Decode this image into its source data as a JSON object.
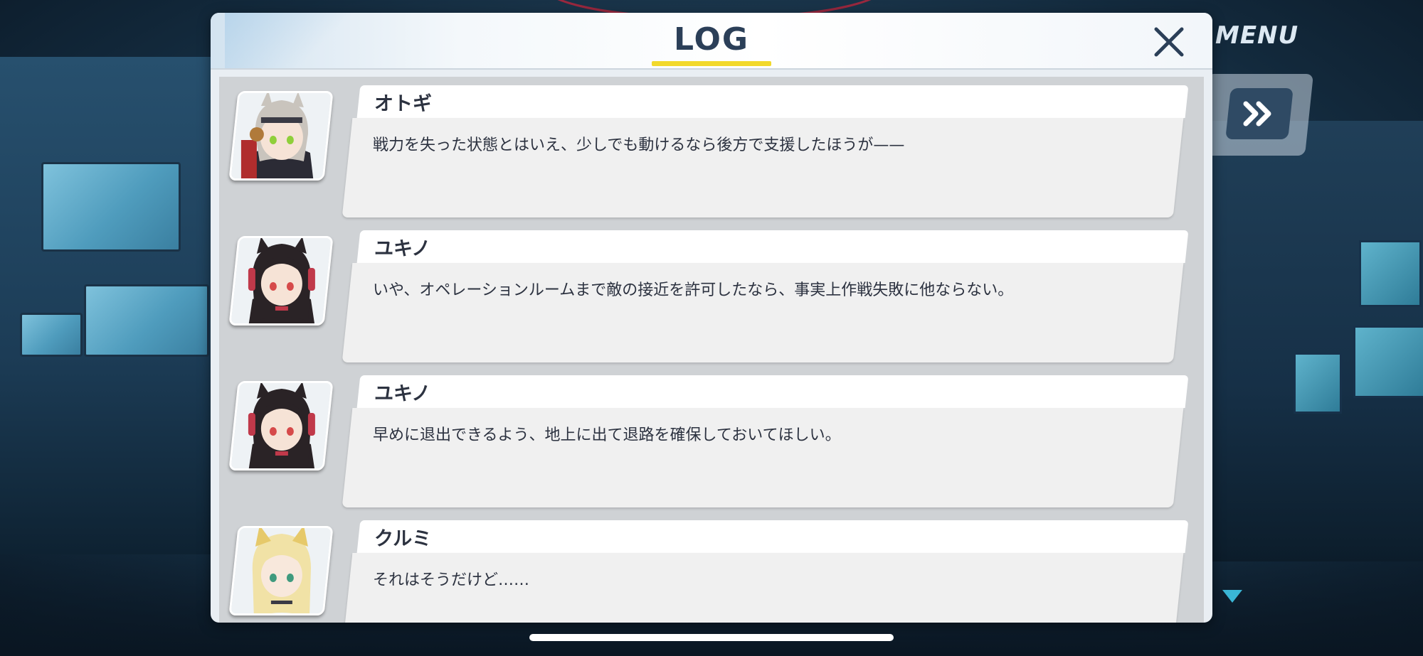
{
  "header": {
    "title": "LOG",
    "close_icon": "close-icon"
  },
  "hud": {
    "menu_label": "MENU",
    "fast_forward_icon": "fast-forward-icon",
    "scroll_indicator_icon": "triangle-down-icon"
  },
  "entries": [
    {
      "name": "オトギ",
      "text": "戦力を失った状態とはいえ、少しでも動けるなら後方で支援したほうが——",
      "portrait": {
        "hair": "#c9c4bd",
        "eye": "#8fcf3a",
        "accent": "#b07a3a"
      }
    },
    {
      "name": "ユキノ",
      "text": "いや、オペレーションルームまで敵の接近を許可したなら、事実上作戦失敗に他ならない。",
      "portrait": {
        "hair": "#2a2326",
        "eye": "#d64a4a",
        "accent": "#c0394a"
      }
    },
    {
      "name": "ユキノ",
      "text": "早めに退出できるよう、地上に出て退路を確保しておいてほしい。",
      "portrait": {
        "hair": "#2a2326",
        "eye": "#d64a4a",
        "accent": "#c0394a"
      }
    },
    {
      "name": "クルミ",
      "text": "それはそうだけど……",
      "portrait": {
        "hair": "#f1e2a6",
        "eye": "#3f9a7e",
        "accent": "#e6c96a"
      }
    }
  ],
  "colors": {
    "accent_yellow": "#f2d92b",
    "title_navy": "#2b3f58"
  }
}
